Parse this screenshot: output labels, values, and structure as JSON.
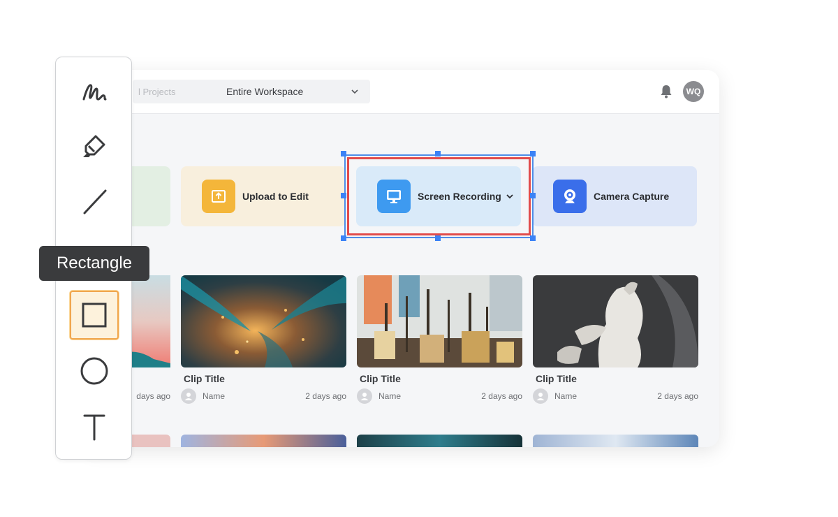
{
  "header": {
    "search_placeholder": "l Projects",
    "scope_label": "Entire Workspace",
    "avatar_initials": "WQ"
  },
  "cards": [
    {
      "label": "Upload to Edit",
      "icon": "upload-icon",
      "color": "#f4b63a"
    },
    {
      "label": "Screen Recording",
      "icon": "monitor-icon",
      "color": "#3e9af0"
    },
    {
      "label": "Camera Capture",
      "icon": "webcam-icon",
      "color": "#3a6eea"
    }
  ],
  "partial_clip": {
    "time": "days ago"
  },
  "clips": [
    {
      "title": "Clip Title",
      "author": "Name",
      "time": "2 days ago"
    },
    {
      "title": "Clip Title",
      "author": "Name",
      "time": "2 days ago"
    },
    {
      "title": "Clip Title",
      "author": "Name",
      "time": "2 days ago"
    }
  ],
  "toolbar": {
    "tools": [
      "freehand-icon",
      "highlighter-icon",
      "line-icon",
      "rectangle-icon",
      "circle-icon",
      "text-icon"
    ],
    "active_tool": "rectangle",
    "tooltip": "Rectangle",
    "accent": "#f0a64d"
  },
  "selection_color": "#4d8de8",
  "highlight_color": "#e14b4b"
}
